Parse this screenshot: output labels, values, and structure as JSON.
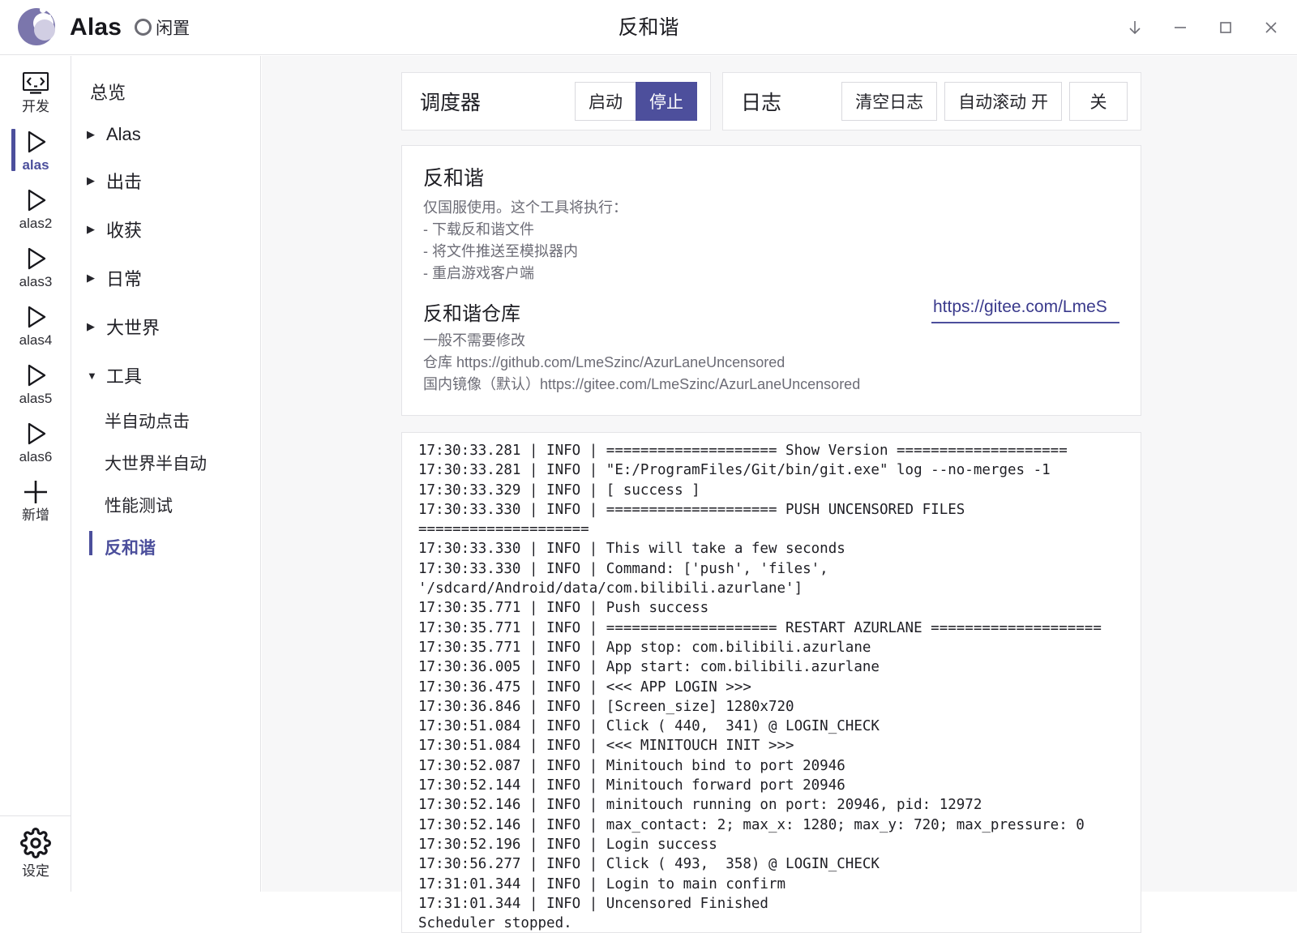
{
  "titlebar": {
    "app_name": "Alas",
    "status": "闲置",
    "window_title": "反和谐",
    "controls": [
      {
        "name": "download-icon",
        "glyph": "↓"
      },
      {
        "name": "minimize-icon",
        "glyph": "—"
      },
      {
        "name": "maximize-icon",
        "glyph": "▢"
      },
      {
        "name": "close-icon",
        "glyph": "✕"
      }
    ]
  },
  "rail": {
    "items": [
      {
        "label": "开发",
        "icon": "code-icon",
        "active": false
      },
      {
        "label": "alas",
        "icon": "play-icon",
        "active": true
      },
      {
        "label": "alas2",
        "icon": "play-icon",
        "active": false
      },
      {
        "label": "alas3",
        "icon": "play-icon",
        "active": false
      },
      {
        "label": "alas4",
        "icon": "play-icon",
        "active": false
      },
      {
        "label": "alas5",
        "icon": "play-icon",
        "active": false
      },
      {
        "label": "alas6",
        "icon": "play-icon",
        "active": false
      },
      {
        "label": "新增",
        "icon": "plus-icon",
        "active": false
      }
    ],
    "settings": {
      "label": "设定",
      "icon": "gear-icon"
    }
  },
  "menu": {
    "overview": "总览",
    "groups": [
      {
        "label": "Alas",
        "expanded": false
      },
      {
        "label": "出击",
        "expanded": false
      },
      {
        "label": "收获",
        "expanded": false
      },
      {
        "label": "日常",
        "expanded": false
      },
      {
        "label": "大世界",
        "expanded": false
      },
      {
        "label": "工具",
        "expanded": true
      }
    ],
    "tool_items": [
      {
        "label": "半自动点击",
        "active": false
      },
      {
        "label": "大世界半自动",
        "active": false
      },
      {
        "label": "性能测试",
        "active": false
      },
      {
        "label": "反和谐",
        "active": true
      }
    ],
    "caret_collapsed": "▶",
    "caret_expanded": "▼"
  },
  "scheduler_card": {
    "title": "调度器",
    "start_label": "启动",
    "stop_label": "停止"
  },
  "log_card": {
    "title": "日志",
    "clear_label": "清空日志",
    "autoscroll_on_label": "自动滚动 开",
    "autoscroll_off_label": "关"
  },
  "description": {
    "heading": "反和谐",
    "lines": [
      "仅国服使用。这个工具将执行：",
      "- 下载反和谐文件",
      "- 将文件推送至模拟器内",
      "- 重启游戏客户端"
    ],
    "repo_heading": "反和谐仓库",
    "repo_lines": [
      "一般不需要修改",
      "仓库 https://github.com/LmeSzinc/AzurLaneUncensored",
      "国内镜像（默认）https://gitee.com/LmeSzinc/AzurLaneUncensored"
    ],
    "repo_input_value": "https://gitee.com/LmeS"
  },
  "log": {
    "lines": [
      "17:30:33.281 | INFO | ==================== Show Version ====================",
      "17:30:33.281 | INFO | \"E:/ProgramFiles/Git/bin/git.exe\" log --no-merges -1",
      "17:30:33.329 | INFO | [ success ]",
      "17:30:33.330 | INFO | ==================== PUSH UNCENSORED FILES ====================",
      "17:30:33.330 | INFO | This will take a few seconds",
      "17:30:33.330 | INFO | Command: ['push', 'files', '/sdcard/Android/data/com.bilibili.azurlane']",
      "17:30:35.771 | INFO | Push success",
      "17:30:35.771 | INFO | ==================== RESTART AZURLANE ====================",
      "17:30:35.771 | INFO | App stop: com.bilibili.azurlane",
      "17:30:36.005 | INFO | App start: com.bilibili.azurlane",
      "17:30:36.475 | INFO | <<< APP LOGIN >>>",
      "17:30:36.846 | INFO | [Screen_size] 1280x720",
      "17:30:51.084 | INFO | Click ( 440,  341) @ LOGIN_CHECK",
      "17:30:51.084 | INFO | <<< MINITOUCH INIT >>>",
      "17:30:52.087 | INFO | Minitouch bind to port 20946",
      "17:30:52.144 | INFO | Minitouch forward port 20946",
      "17:30:52.146 | INFO | minitouch running on port: 20946, pid: 12972",
      "17:30:52.146 | INFO | max_contact: 2; max_x: 1280; max_y: 720; max_pressure: 0",
      "17:30:52.196 | INFO | Login success",
      "17:30:56.277 | INFO | Click ( 493,  358) @ LOGIN_CHECK",
      "17:31:01.344 | INFO | Login to main confirm",
      "17:31:01.344 | INFO | Uncensored Finished",
      "Scheduler stopped."
    ]
  },
  "colors": {
    "accent": "#4c4f9c",
    "accent_text": "#3a3a8c",
    "panel_bg": "#f7f7f8",
    "border": "#e4e4e7",
    "muted_text": "#6c6c76"
  }
}
